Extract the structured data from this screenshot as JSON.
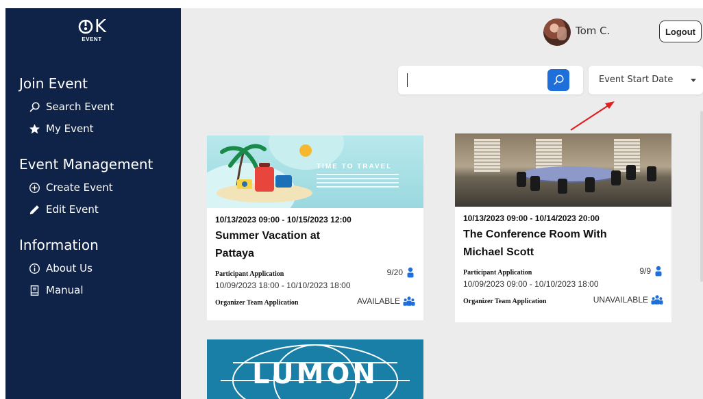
{
  "brand": {
    "logo_mark": "OK",
    "logo_sub": "EVENT"
  },
  "sidebar": {
    "sections": [
      {
        "heading": "Join Event",
        "items": [
          {
            "label": "Search Event",
            "icon": "search-icon"
          },
          {
            "label": "My Event",
            "icon": "star-icon"
          }
        ]
      },
      {
        "heading": "Event Management",
        "items": [
          {
            "label": "Create Event",
            "icon": "plus-circle-icon"
          },
          {
            "label": "Edit Event",
            "icon": "pencil-icon"
          }
        ]
      },
      {
        "heading": "Information",
        "items": [
          {
            "label": "About Us",
            "icon": "info-circle-icon"
          },
          {
            "label": "Manual",
            "icon": "book-icon"
          }
        ]
      }
    ]
  },
  "header": {
    "username": "Tom C.",
    "logout_label": "Logout"
  },
  "search": {
    "value": "",
    "sort_selected": "Event Start Date"
  },
  "colors": {
    "sidebar_bg": "#0f2248",
    "accent": "#1e6fd9",
    "page_bg": "#ececec"
  },
  "events": [
    {
      "dates": "10/13/2023 09:00 - 10/15/2023 12:00",
      "title_line1": "Summer Vacation at",
      "title_line2": "Pattaya",
      "image_text": "TIME TO TRAVEL",
      "participant_label": "Participant Application",
      "participant_count": "9/20",
      "participant_dates": "10/09/2023 18:00 - 10/10/2023 18:00",
      "organizer_label": "Organizer Team Application",
      "organizer_status": "AVAILABLE"
    },
    {
      "dates": "10/13/2023 09:00 - 10/14/2023 20:00",
      "title_line1": "The Conference Room With",
      "title_line2": "Michael Scott",
      "participant_label": "Participant Application",
      "participant_count": "9/9",
      "participant_dates": "10/09/2023 09:00 - 10/10/2023 18:00",
      "organizer_label": "Organizer Team Application",
      "organizer_status": "UNAVAILABLE"
    },
    {
      "image_text": "LUMON"
    }
  ]
}
